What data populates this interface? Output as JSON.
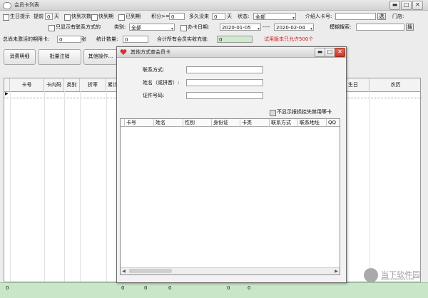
{
  "window": {
    "title": "会员卡列表",
    "min": "▬",
    "max": "□",
    "close": "✕"
  },
  "row1": {
    "birthday": "生日提示",
    "ahead": "提前",
    "ahead_value": "0",
    "days": "天",
    "expiring_count": "快到次数",
    "expiring": "快到期",
    "expired": "已到期",
    "points_label": "积分>=",
    "points_value": "0",
    "absent_label": "多久没来",
    "absent_value": "0",
    "absent_unit": "天",
    "status_label": "状态:",
    "status_value": "全部",
    "referrer_label": "介绍人卡号:",
    "select_btn": "选",
    "store_label": "门店:"
  },
  "row2": {
    "only_contact": "只显示有联系方式的",
    "category_label": "类别:",
    "category_value": "全部",
    "card_date": "办卡日期:",
    "date_from": "2020-01-05",
    "date_sep": "----",
    "date_to": "2020-02-04",
    "fuzzy_label": "模糊搜索:",
    "search_btn": "搜"
  },
  "row3": {
    "unactivated_label": "总尚未激活的期限卡:",
    "unactivated_value": "0",
    "unactivated_unit": "张",
    "stat_label": "统计数量:",
    "stat_value": "0",
    "recharge_label": "合计所有会员实收充值:",
    "recharge_value": "0",
    "trial_note": "试用版本只允许500个"
  },
  "buttons": {
    "consume": "消费明细",
    "batch": "批量注销",
    "other": "其他操作..."
  },
  "grid": {
    "columns_left": [
      "卡号",
      "卡内码",
      "类别",
      "折率",
      "累计"
    ],
    "columns_right": [
      "生日",
      "农历"
    ]
  },
  "status_bar": {
    "values": [
      "0",
      "0",
      "0",
      "0",
      "0",
      "0"
    ]
  },
  "dialog": {
    "title": "其他方式查会员卡",
    "contact_label": "联系方式:",
    "name_label": "姓名（或拼音）:",
    "id_label": "证件号码:",
    "hide_lost": "不显示报损挂失禁用等卡",
    "columns": [
      "卡号",
      "姓名",
      "性别",
      "身份证",
      "卡类",
      "联系方式",
      "联系地址",
      "QQ"
    ]
  },
  "watermark": {
    "text": "当下软件园",
    "sub": "www.downxia.com"
  },
  "colors": {
    "accent_red": "#d21b1b",
    "status_green": "#c9e6c9"
  }
}
